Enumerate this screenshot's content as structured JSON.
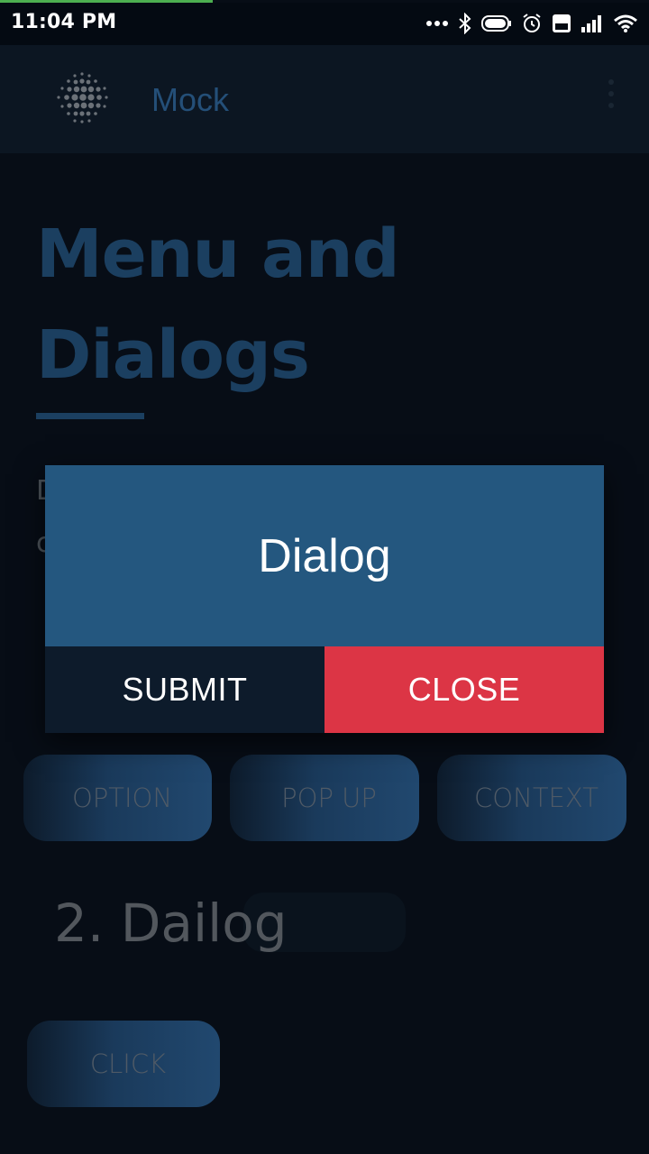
{
  "status_bar": {
    "time": "11:04 PM"
  },
  "app_bar": {
    "title": "Mock"
  },
  "page": {
    "heading": "Menu and Dialogs",
    "description_peek": "D c",
    "menu_buttons": [
      "OPTION",
      "POP UP",
      "CONTEXT"
    ],
    "section_title": "2. Dailog",
    "click_label": "CLICK"
  },
  "dialog": {
    "title": "Dialog",
    "submit_label": "SUBMIT",
    "close_label": "CLOSE"
  },
  "colors": {
    "background": "#070d16",
    "app_bar": "#0c1622",
    "accent": "#24577f",
    "close_red": "#dc3545",
    "submit_dark": "#0d1b2b"
  },
  "icons": {
    "logo": "dotted-sphere-logo",
    "overflow": "kebab-menu-icon",
    "status": [
      "more-dots-icon",
      "bluetooth-icon",
      "battery-icon",
      "alarm-icon",
      "volte-icon",
      "signal-icon",
      "wifi-icon"
    ]
  }
}
